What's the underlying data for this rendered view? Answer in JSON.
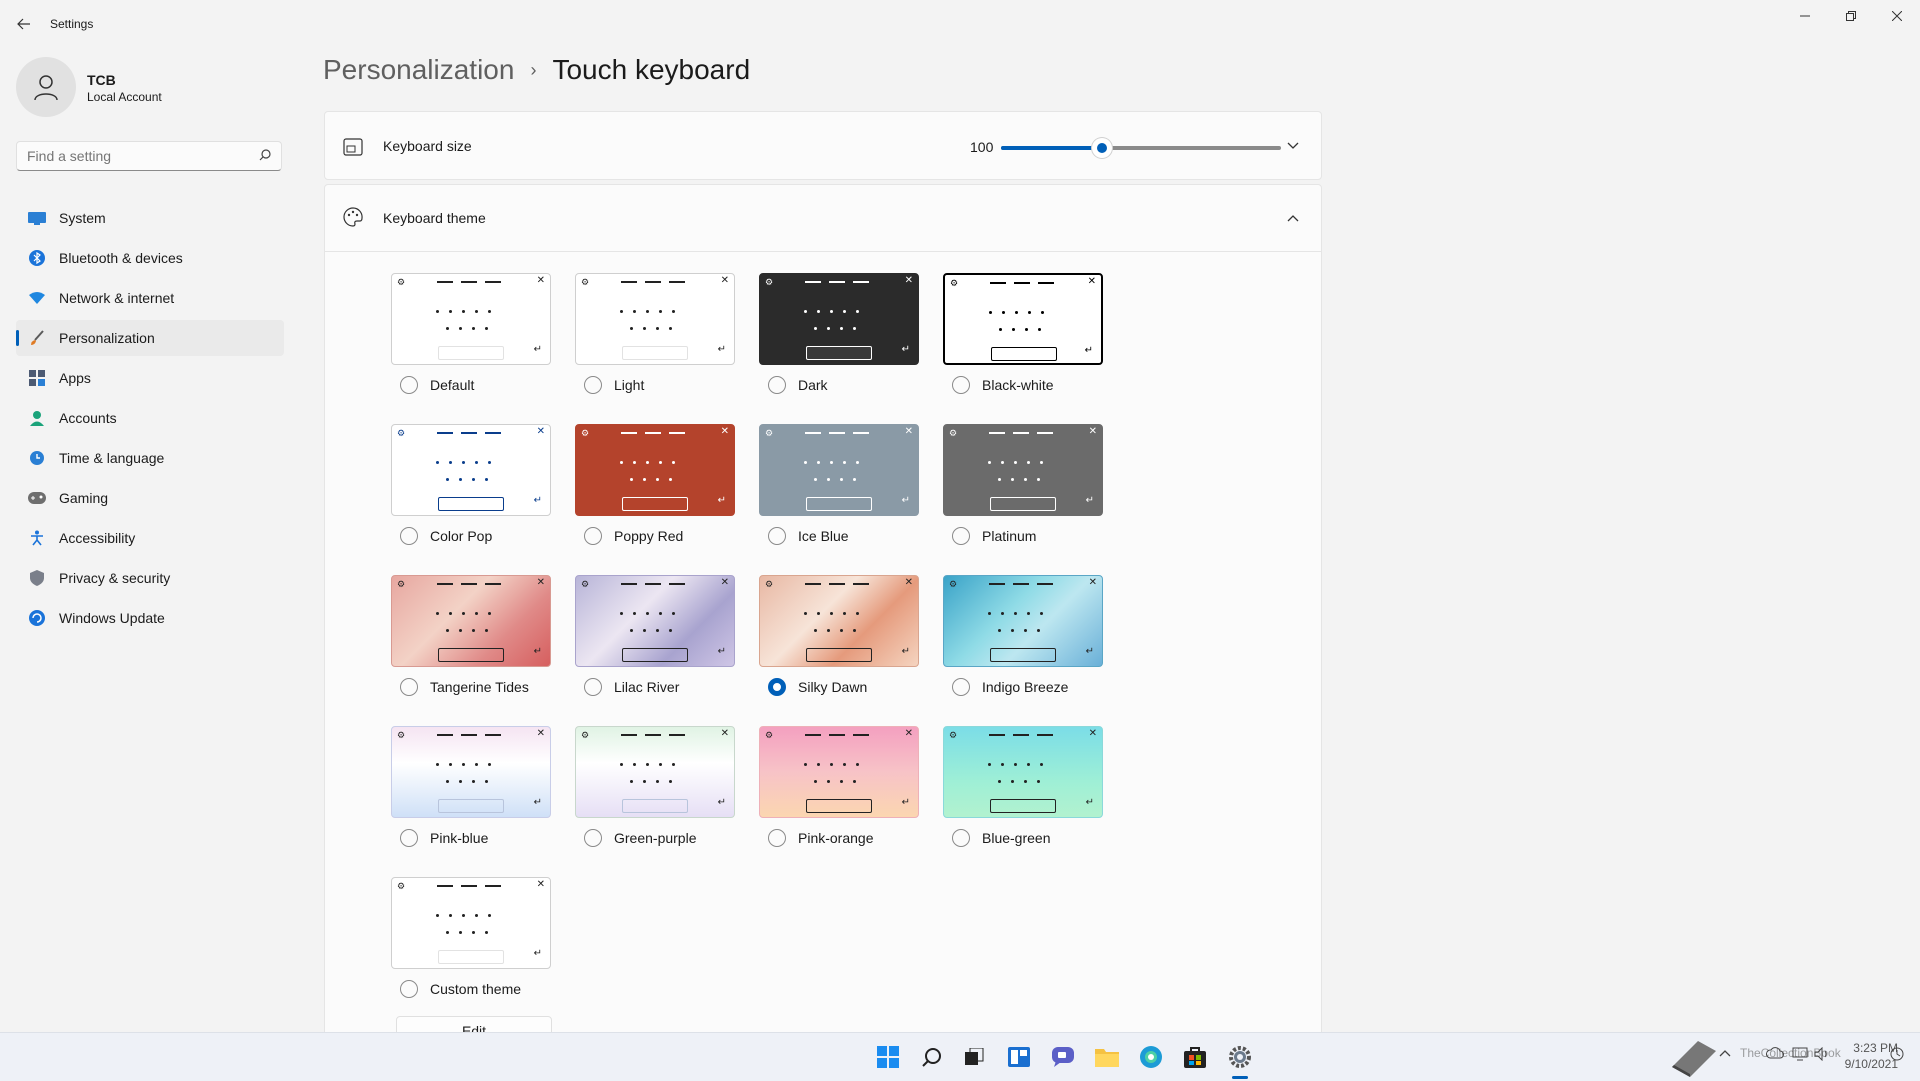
{
  "app": {
    "title": "Settings"
  },
  "account": {
    "name": "TCB",
    "type": "Local Account"
  },
  "search": {
    "placeholder": "Find a setting"
  },
  "nav": [
    {
      "label": "System",
      "icon": "monitor-icon"
    },
    {
      "label": "Bluetooth & devices",
      "icon": "bluetooth-icon"
    },
    {
      "label": "Network & internet",
      "icon": "wifi-icon"
    },
    {
      "label": "Personalization",
      "icon": "brush-icon",
      "active": true
    },
    {
      "label": "Apps",
      "icon": "apps-icon"
    },
    {
      "label": "Accounts",
      "icon": "person-icon"
    },
    {
      "label": "Time & language",
      "icon": "clock-globe-icon"
    },
    {
      "label": "Gaming",
      "icon": "gamepad-icon"
    },
    {
      "label": "Accessibility",
      "icon": "accessibility-icon"
    },
    {
      "label": "Privacy & security",
      "icon": "shield-icon"
    },
    {
      "label": "Windows Update",
      "icon": "update-icon"
    }
  ],
  "breadcrumb": {
    "parent": "Personalization",
    "separator": "›",
    "current": "Touch keyboard"
  },
  "keyboard_size": {
    "label": "Keyboard size",
    "value": "100",
    "slider_fraction": 0.36
  },
  "keyboard_theme": {
    "label": "Keyboard theme",
    "selected": "Silky Dawn",
    "themes": [
      "Default",
      "Light",
      "Dark",
      "Black-white",
      "Color Pop",
      "Poppy Red",
      "Ice Blue",
      "Platinum",
      "Tangerine Tides",
      "Lilac River",
      "Silky Dawn",
      "Indigo Breeze",
      "Pink-blue",
      "Green-purple",
      "Pink-orange",
      "Blue-green",
      "Custom theme"
    ],
    "edit_label": "Edit"
  },
  "taskbar": {
    "time": "3:23 PM",
    "date": "9/10/2021",
    "watermark": "TheCollectionBook"
  },
  "colors": {
    "accent": "#005fb8",
    "background": "#f3f3f3"
  }
}
